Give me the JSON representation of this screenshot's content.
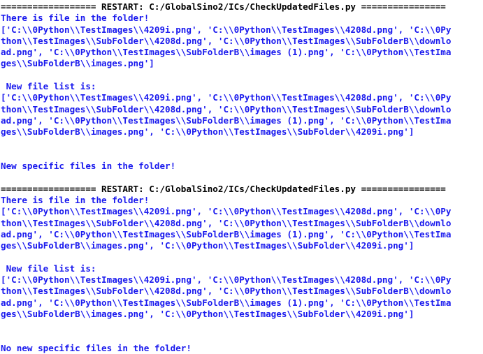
{
  "window": {
    "app": "Python IDLE Shell",
    "background_color": "#ffffff",
    "stdout_color": "#1a1aee",
    "restart_color": "#000000"
  },
  "console": {
    "script_path": "C:/GlobalSino2/ICs/CheckUpdatedFiles.py",
    "lines": [
      {
        "id": "restart-banner-1",
        "kind": "restart",
        "text": "================== RESTART: C:/GlobalSino2/ICs/CheckUpdatedFiles.py ================"
      },
      {
        "id": "status-there-is-file-1",
        "kind": "stdout",
        "text": "There is file in the folder!"
      },
      {
        "id": "file-list-1-line-1",
        "kind": "stdout",
        "text": "['C:\\\\0Python\\\\TestImages\\\\4209i.png', 'C:\\\\0Python\\\\TestImages\\\\4208d.png', 'C:\\\\0Py"
      },
      {
        "id": "file-list-1-line-2",
        "kind": "stdout",
        "text": "thon\\\\TestImages\\\\SubFolder\\\\4208d.png', 'C:\\\\0Python\\\\TestImages\\\\SubFolderB\\\\downlo"
      },
      {
        "id": "file-list-1-line-3",
        "kind": "stdout",
        "text": "ad.png', 'C:\\\\0Python\\\\TestImages\\\\SubFolderB\\\\images (1).png', 'C:\\\\0Python\\\\TestIma"
      },
      {
        "id": "file-list-1-line-4",
        "kind": "stdout",
        "text": "ges\\\\SubFolderB\\\\images.png']"
      },
      {
        "id": "blank-1",
        "kind": "blank",
        "text": " "
      },
      {
        "id": "label-new-file-list-1",
        "kind": "stdout",
        "text": " New file list is:"
      },
      {
        "id": "new-file-list-1-line-1",
        "kind": "stdout",
        "text": "['C:\\\\0Python\\\\TestImages\\\\4209i.png', 'C:\\\\0Python\\\\TestImages\\\\4208d.png', 'C:\\\\0Py"
      },
      {
        "id": "new-file-list-1-line-2",
        "kind": "stdout",
        "text": "thon\\\\TestImages\\\\SubFolder\\\\4208d.png', 'C:\\\\0Python\\\\TestImages\\\\SubFolderB\\\\downlo"
      },
      {
        "id": "new-file-list-1-line-3",
        "kind": "stdout",
        "text": "ad.png', 'C:\\\\0Python\\\\TestImages\\\\SubFolderB\\\\images (1).png', 'C:\\\\0Python\\\\TestIma"
      },
      {
        "id": "new-file-list-1-line-4",
        "kind": "stdout",
        "text": "ges\\\\SubFolderB\\\\images.png', 'C:\\\\0Python\\\\TestImages\\\\SubFolder\\\\4209i.png']"
      },
      {
        "id": "blank-2",
        "kind": "blank",
        "text": " "
      },
      {
        "id": "blank-3",
        "kind": "blank",
        "text": " "
      },
      {
        "id": "status-new-specific-files",
        "kind": "stdout",
        "text": "New specific files in the folder!"
      },
      {
        "id": "blank-4",
        "kind": "blank",
        "text": " "
      },
      {
        "id": "restart-banner-2",
        "kind": "restart",
        "text": "================== RESTART: C:/GlobalSino2/ICs/CheckUpdatedFiles.py ================"
      },
      {
        "id": "status-there-is-file-2",
        "kind": "stdout",
        "text": "There is file in the folder!"
      },
      {
        "id": "file-list-2-line-1",
        "kind": "stdout",
        "text": "['C:\\\\0Python\\\\TestImages\\\\4209i.png', 'C:\\\\0Python\\\\TestImages\\\\4208d.png', 'C:\\\\0Py"
      },
      {
        "id": "file-list-2-line-2",
        "kind": "stdout",
        "text": "thon\\\\TestImages\\\\SubFolder\\\\4208d.png', 'C:\\\\0Python\\\\TestImages\\\\SubFolderB\\\\downlo"
      },
      {
        "id": "file-list-2-line-3",
        "kind": "stdout",
        "text": "ad.png', 'C:\\\\0Python\\\\TestImages\\\\SubFolderB\\\\images (1).png', 'C:\\\\0Python\\\\TestIma"
      },
      {
        "id": "file-list-2-line-4",
        "kind": "stdout",
        "text": "ges\\\\SubFolderB\\\\images.png', 'C:\\\\0Python\\\\TestImages\\\\SubFolder\\\\4209i.png']"
      },
      {
        "id": "blank-5",
        "kind": "blank",
        "text": " "
      },
      {
        "id": "label-new-file-list-2",
        "kind": "stdout",
        "text": " New file list is:"
      },
      {
        "id": "new-file-list-2-line-1",
        "kind": "stdout",
        "text": "['C:\\\\0Python\\\\TestImages\\\\4209i.png', 'C:\\\\0Python\\\\TestImages\\\\4208d.png', 'C:\\\\0Py"
      },
      {
        "id": "new-file-list-2-line-2",
        "kind": "stdout",
        "text": "thon\\\\TestImages\\\\SubFolder\\\\4208d.png', 'C:\\\\0Python\\\\TestImages\\\\SubFolderB\\\\downlo"
      },
      {
        "id": "new-file-list-2-line-3",
        "kind": "stdout",
        "text": "ad.png', 'C:\\\\0Python\\\\TestImages\\\\SubFolderB\\\\images (1).png', 'C:\\\\0Python\\\\TestIma"
      },
      {
        "id": "new-file-list-2-line-4",
        "kind": "stdout",
        "text": "ges\\\\SubFolderB\\\\images.png', 'C:\\\\0Python\\\\TestImages\\\\SubFolder\\\\4209i.png']"
      },
      {
        "id": "blank-6",
        "kind": "blank",
        "text": " "
      },
      {
        "id": "blank-7",
        "kind": "blank",
        "text": " "
      },
      {
        "id": "status-no-new-specific-files",
        "kind": "stdout",
        "text": "No new specific files in the folder!"
      }
    ]
  }
}
